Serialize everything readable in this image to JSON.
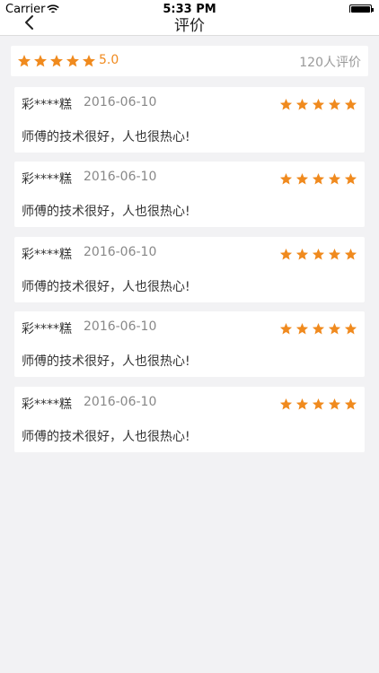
{
  "statusbar": {
    "carrier": "Carrier",
    "time": "5:33 PM"
  },
  "navbar": {
    "title": "评价"
  },
  "summary": {
    "rating": 5,
    "score": "5.0",
    "count": "120人评价"
  },
  "colors": {
    "star": "#f08a1e",
    "background": "#f2f2f4"
  },
  "reviews": [
    {
      "user": "彩****糕",
      "date": "2016-06-10",
      "rating": 5,
      "text": "师傅的技术很好，人也很热心!"
    },
    {
      "user": "彩****糕",
      "date": "2016-06-10",
      "rating": 5,
      "text": "师傅的技术很好，人也很热心!"
    },
    {
      "user": "彩****糕",
      "date": "2016-06-10",
      "rating": 5,
      "text": "师傅的技术很好，人也很热心!"
    },
    {
      "user": "彩****糕",
      "date": "2016-06-10",
      "rating": 5,
      "text": "师傅的技术很好，人也很热心!"
    },
    {
      "user": "彩****糕",
      "date": "2016-06-10",
      "rating": 5,
      "text": "师傅的技术很好，人也很热心!"
    }
  ]
}
